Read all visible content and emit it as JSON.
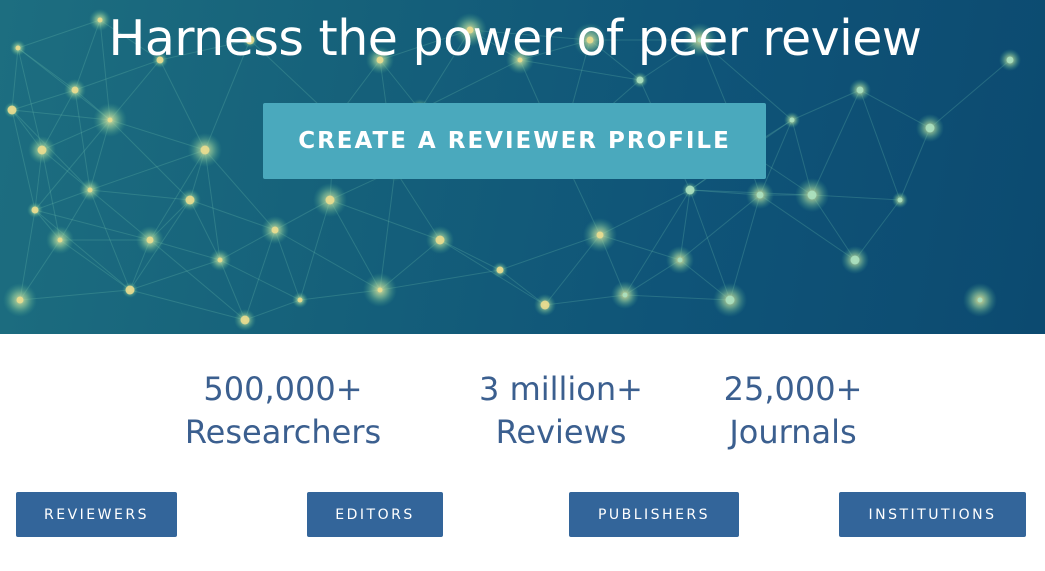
{
  "hero": {
    "title": "Harness the power of peer review",
    "cta_label": "CREATE A REVIEWER PROFILE"
  },
  "stats": [
    {
      "number": "500,000+",
      "label": "Researchers"
    },
    {
      "number": "3 million+",
      "label": "Reviews"
    },
    {
      "number": "25,000+",
      "label": "Journals"
    }
  ],
  "nav": {
    "reviewers": "REVIEWERS",
    "editors": "EDITORS",
    "publishers": "PUBLISHERS",
    "institutions": "INSTITUTIONS"
  },
  "colors": {
    "hero_dark": "#0c4a70",
    "hero_teal": "#1d6e80",
    "cta": "#4aa9bd",
    "stat_text": "#3b5f8f",
    "nav_button": "#33659a"
  }
}
